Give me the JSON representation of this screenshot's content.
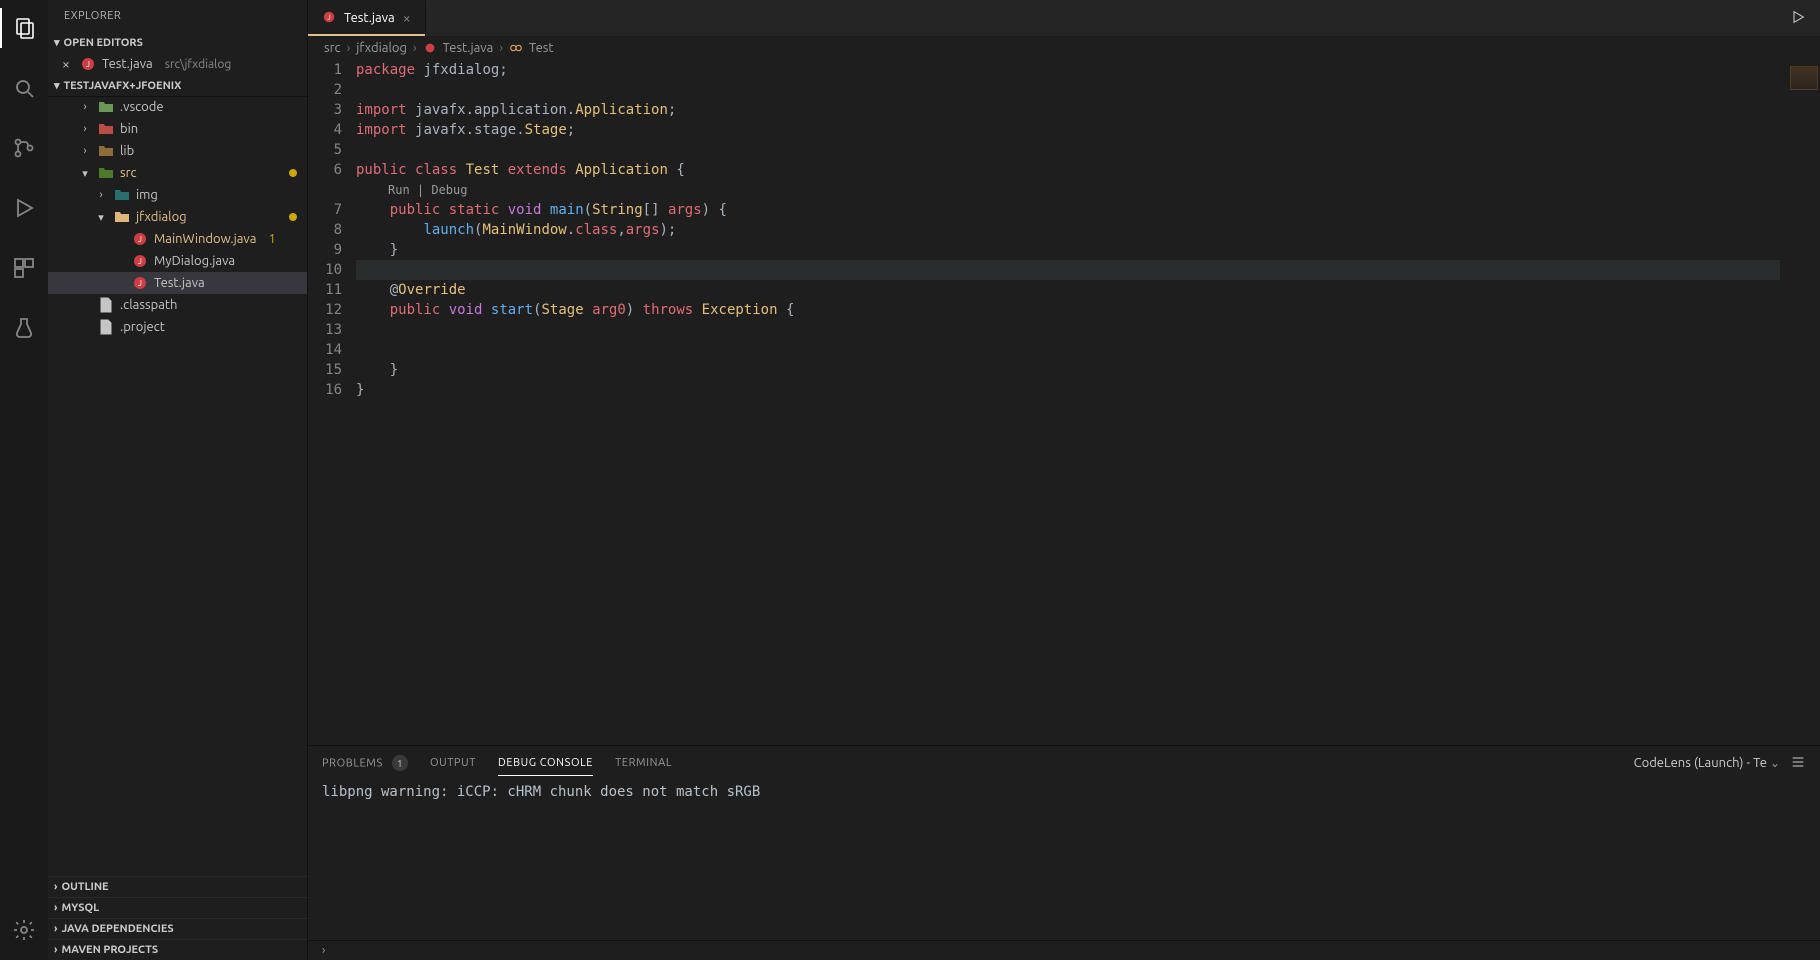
{
  "sidebar": {
    "title": "EXPLORER",
    "open_editors_label": "OPEN EDITORS",
    "open_editors": [
      {
        "name": "Test.java",
        "path": "src\\jfxdialog"
      }
    ],
    "project_label": "TESTJAVAFX+JFOENIX",
    "tree": {
      "vscode": {
        "label": ".vscode"
      },
      "bin": {
        "label": "bin"
      },
      "lib": {
        "label": "lib"
      },
      "src": {
        "label": "src"
      },
      "img": {
        "label": "img"
      },
      "jfxdialog": {
        "label": "jfxdialog"
      },
      "mainwin": {
        "label": "MainWindow.java",
        "badge": "1"
      },
      "mydialog": {
        "label": "MyDialog.java"
      },
      "test": {
        "label": "Test.java"
      },
      "classpath": {
        "label": ".classpath"
      },
      "project": {
        "label": ".project"
      }
    },
    "bottom_sections": [
      "OUTLINE",
      "MYSQL",
      "JAVA DEPENDENCIES",
      "MAVEN PROJECTS"
    ]
  },
  "tab": {
    "title": "Test.java"
  },
  "breadcrumbs": [
    "src",
    "jfxdialog",
    "Test.java",
    "Test"
  ],
  "codelens": "Run | Debug",
  "code": [
    {
      "n": 1,
      "seg": [
        [
          "kw2",
          "package "
        ],
        [
          "ident",
          "jfxdialog"
        ],
        [
          "pun",
          ";"
        ]
      ]
    },
    {
      "n": 2,
      "seg": []
    },
    {
      "n": 3,
      "seg": [
        [
          "kw2",
          "import "
        ],
        [
          "ident",
          "javafx"
        ],
        [
          "pun",
          "."
        ],
        [
          "ident",
          "application"
        ],
        [
          "pun",
          "."
        ],
        [
          "type",
          "Application"
        ],
        [
          "pun",
          ";"
        ]
      ]
    },
    {
      "n": 4,
      "seg": [
        [
          "kw2",
          "import "
        ],
        [
          "ident",
          "javafx"
        ],
        [
          "pun",
          "."
        ],
        [
          "ident",
          "stage"
        ],
        [
          "pun",
          "."
        ],
        [
          "type",
          "Stage"
        ],
        [
          "pun",
          ";"
        ]
      ]
    },
    {
      "n": 5,
      "seg": []
    },
    {
      "n": 6,
      "seg": [
        [
          "kw2",
          "public "
        ],
        [
          "kw2",
          "class "
        ],
        [
          "type",
          "Test "
        ],
        [
          "kw2",
          "extends "
        ],
        [
          "type",
          "Application "
        ],
        [
          "pun",
          "{"
        ]
      ]
    },
    {
      "n": 0,
      "lens": true
    },
    {
      "n": 7,
      "seg": [
        [
          "ident",
          "    "
        ],
        [
          "kw2",
          "public "
        ],
        [
          "kw2",
          "static "
        ],
        [
          "kw",
          "void "
        ],
        [
          "fn",
          "main"
        ],
        [
          "pun",
          "("
        ],
        [
          "type",
          "String"
        ],
        [
          "pun",
          "[] "
        ],
        [
          "var",
          "args"
        ],
        [
          "pun",
          ") {"
        ]
      ]
    },
    {
      "n": 8,
      "seg": [
        [
          "ident",
          "        "
        ],
        [
          "fn",
          "launch"
        ],
        [
          "pun",
          "("
        ],
        [
          "type",
          "MainWindow"
        ],
        [
          "pun",
          "."
        ],
        [
          "kw2",
          "class"
        ],
        [
          "pun",
          ","
        ],
        [
          "var",
          "args"
        ],
        [
          "pun",
          ");"
        ]
      ]
    },
    {
      "n": 9,
      "seg": [
        [
          "ident",
          "    "
        ],
        [
          "pun",
          "}"
        ]
      ]
    },
    {
      "n": 10,
      "hl": true,
      "seg": []
    },
    {
      "n": 11,
      "seg": [
        [
          "ident",
          "    "
        ],
        [
          "ann-at",
          "@"
        ],
        [
          "ann",
          "Override"
        ]
      ]
    },
    {
      "n": 12,
      "seg": [
        [
          "ident",
          "    "
        ],
        [
          "kw2",
          "public "
        ],
        [
          "kw",
          "void "
        ],
        [
          "fn",
          "start"
        ],
        [
          "pun",
          "("
        ],
        [
          "type",
          "Stage "
        ],
        [
          "var",
          "arg0"
        ],
        [
          "pun",
          ") "
        ],
        [
          "kw2",
          "throws "
        ],
        [
          "type",
          "Exception "
        ],
        [
          "pun",
          "{"
        ]
      ]
    },
    {
      "n": 13,
      "seg": []
    },
    {
      "n": 14,
      "seg": []
    },
    {
      "n": 15,
      "seg": [
        [
          "ident",
          "    "
        ],
        [
          "pun",
          "}"
        ]
      ]
    },
    {
      "n": 16,
      "seg": [
        [
          "pun",
          "}"
        ]
      ]
    }
  ],
  "panel": {
    "tabs": {
      "problems": "PROBLEMS",
      "problems_count": "1",
      "output": "OUTPUT",
      "debug_console": "DEBUG CONSOLE",
      "terminal": "TERMINAL"
    },
    "launch_selector": "CodeLens (Launch) - Te",
    "output_line": "libpng warning: iCCP: cHRM chunk does not match sRGB",
    "footer_chevron": "›"
  }
}
